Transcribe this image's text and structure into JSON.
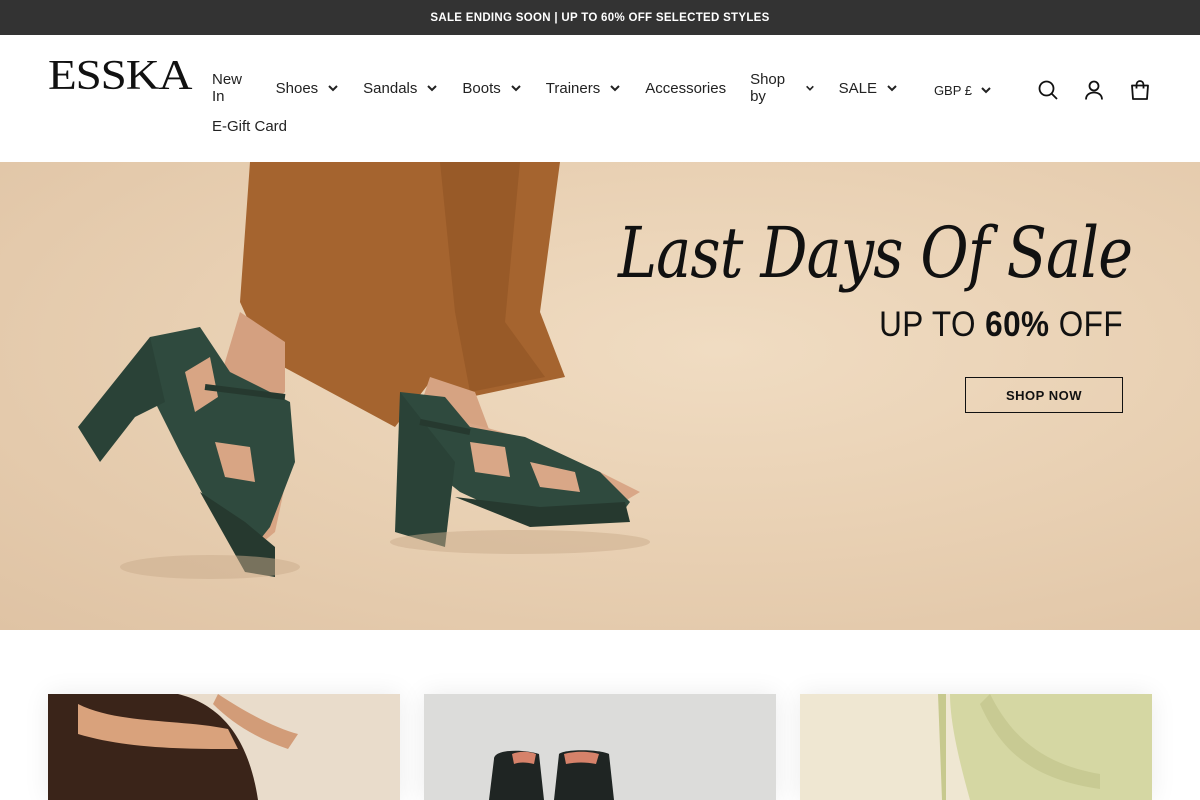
{
  "announcement": {
    "text": "SALE ENDING SOON | UP TO 60% OFF SELECTED STYLES"
  },
  "header": {
    "logo": "ESSKA",
    "nav": [
      {
        "label": "New In",
        "has_dropdown": false
      },
      {
        "label": "Shoes",
        "has_dropdown": true
      },
      {
        "label": "Sandals",
        "has_dropdown": true
      },
      {
        "label": "Boots",
        "has_dropdown": true
      },
      {
        "label": "Trainers",
        "has_dropdown": true
      },
      {
        "label": "Accessories",
        "has_dropdown": false
      },
      {
        "label": "Shop by",
        "has_dropdown": true
      },
      {
        "label": "SALE",
        "has_dropdown": true
      },
      {
        "label": "E-Gift Card",
        "has_dropdown": false
      }
    ],
    "currency": "GBP £",
    "icons": [
      "search-icon",
      "account-icon",
      "cart-icon"
    ]
  },
  "hero": {
    "title": "Last Days Of Sale",
    "subtitle_prefix": "UP TO ",
    "subtitle_bold": "60%",
    "subtitle_suffix": " OFF",
    "cta": "SHOP NOW"
  },
  "colors": {
    "announcement_bg": "#333333",
    "hero_bg": "#e9d1b4",
    "trouser": "#a0622e",
    "shoe": "#2f4a3e",
    "skin": "#d7a27f"
  }
}
